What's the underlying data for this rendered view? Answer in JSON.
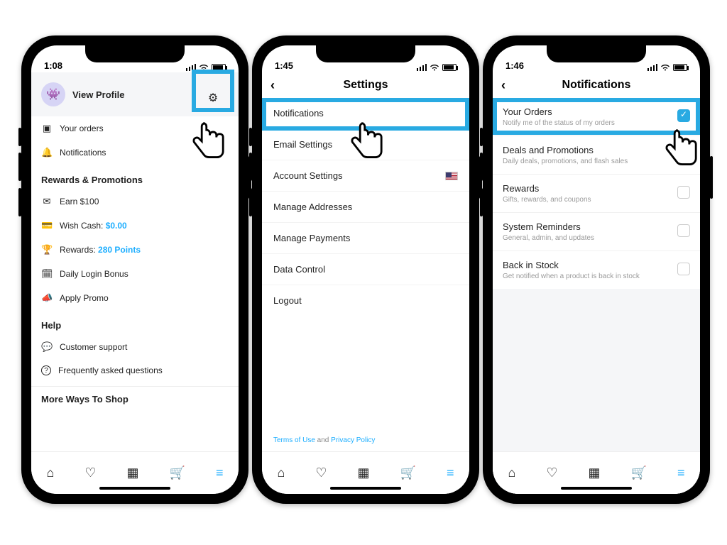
{
  "phone1": {
    "time": "1:08",
    "profile_label": "View Profile",
    "gear_icon": "⚙",
    "quick": [
      {
        "icon": "▣",
        "label": "Your orders"
      },
      {
        "icon": "🔔",
        "label": "Notifications"
      }
    ],
    "rewards_header": "Rewards & Promotions",
    "rewards": {
      "earn": {
        "icon": "✉",
        "label": "Earn $100"
      },
      "wishcash": {
        "icon": "💳",
        "label_prefix": "Wish Cash: ",
        "value": "$0.00"
      },
      "rewards": {
        "icon": "🏆",
        "label_prefix": "Rewards: ",
        "value": "280 Points"
      },
      "daily": {
        "icon": "🗓",
        "label": "Daily Login Bonus"
      },
      "promo": {
        "icon": "📣",
        "label": "Apply Promo"
      }
    },
    "help_header": "Help",
    "help": {
      "support": {
        "icon": "💬",
        "label": "Customer support"
      },
      "faq": {
        "icon": "?",
        "label": "Frequently asked questions"
      }
    },
    "more_header": "More Ways To Shop"
  },
  "phone2": {
    "time": "1:45",
    "title": "Settings",
    "rows": {
      "notifications": "Notifications",
      "email": "Email Settings",
      "account": "Account Settings",
      "addresses": "Manage Addresses",
      "payments": "Manage Payments",
      "data": "Data Control",
      "logout": "Logout"
    },
    "terms": {
      "tou": "Terms of Use",
      "and": " and ",
      "pp": "Privacy Policy"
    }
  },
  "phone3": {
    "time": "1:46",
    "title": "Notifications",
    "rows": [
      {
        "title": "Your Orders",
        "sub": "Notify me of the status of my orders",
        "checked": true
      },
      {
        "title": "Deals and Promotions",
        "sub": "Daily deals, promotions, and flash sales",
        "checked": false
      },
      {
        "title": "Rewards",
        "sub": "Gifts, rewards, and coupons",
        "checked": false
      },
      {
        "title": "System Reminders",
        "sub": "General, admin, and updates",
        "checked": false
      },
      {
        "title": "Back in Stock",
        "sub": "Get notified when a product is back in stock",
        "checked": false
      }
    ]
  },
  "tabs": {
    "home": "⌂",
    "heart": "♡",
    "grid": "▦",
    "cart": "🛒",
    "menu": "≡"
  }
}
